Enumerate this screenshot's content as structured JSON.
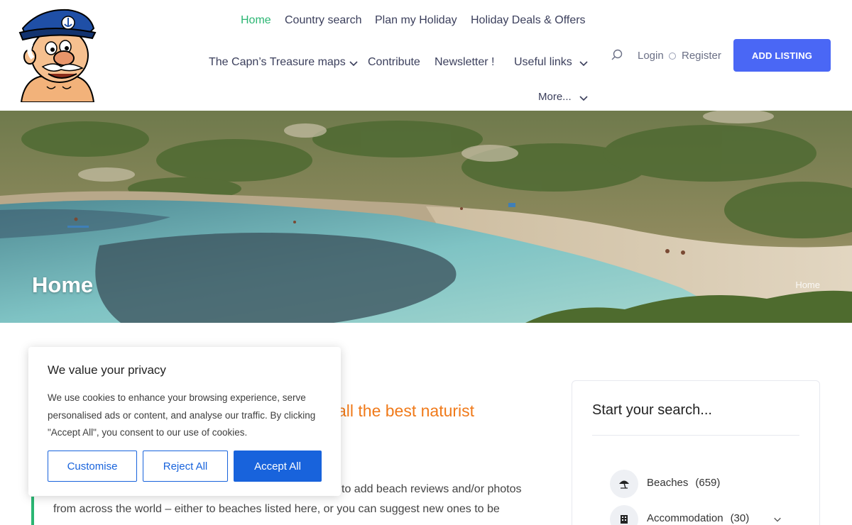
{
  "header": {
    "nav": {
      "home": "Home",
      "country_search": "Country search",
      "plan_holiday": "Plan my Holiday",
      "deals": "Holiday Deals & Offers",
      "treasure_maps": "The Capn’s Treasure maps",
      "contribute": "Contribute",
      "newsletter": "Newsletter !",
      "useful_links": "Useful links",
      "more": "More..."
    },
    "login": "Login",
    "register": "Register",
    "add_listing": "ADD LISTING"
  },
  "hero": {
    "title": "Home",
    "breadcrumb": "Home"
  },
  "content": {
    "headline": "all the best naturist",
    "para_line1": "to add beach reviews and/or photos",
    "para_line2": "from across the world – either to beaches listed here, or you can suggest new ones to be"
  },
  "sidebar": {
    "title": "Start your search...",
    "categories": [
      {
        "label": "Beaches",
        "count": "(659)",
        "icon": "beach-umbrella-icon"
      },
      {
        "label": "Accommodation",
        "count": "(30)",
        "icon": "hotel-icon"
      }
    ]
  },
  "cookie": {
    "title": "We value your privacy",
    "text": "We use cookies to enhance your browsing experience, serve personalised ads or content, and analyse our traffic. By clicking \"Accept All\", you consent to our use of cookies.",
    "customise": "Customise",
    "reject": "Reject All",
    "accept": "Accept All"
  },
  "colors": {
    "accent_green": "#2bb673",
    "button_blue": "#4a67f5",
    "cookie_blue": "#1863dc",
    "headline_orange": "#f07a1a"
  }
}
